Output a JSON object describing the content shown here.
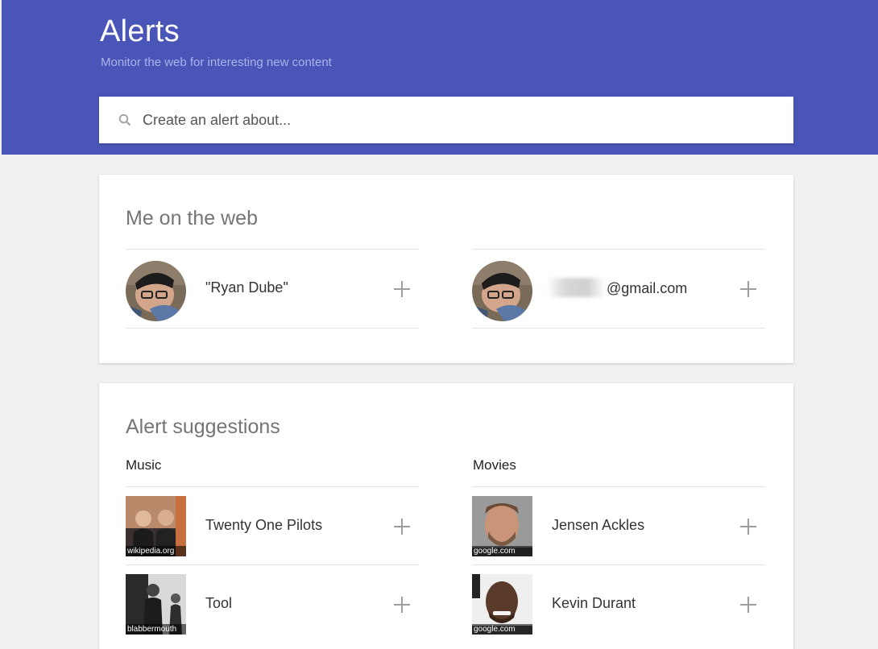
{
  "header": {
    "title": "Alerts",
    "subtitle": "Monitor the web for interesting new content",
    "background": "#4a55b8"
  },
  "search": {
    "placeholder": "Create an alert about...",
    "icon": "search-icon"
  },
  "me_on_web": {
    "title": "Me on the web",
    "items": [
      {
        "label": "\"Ryan Dube\"",
        "icon": "plus-icon"
      },
      {
        "label": "@gmail.com",
        "icon": "plus-icon"
      }
    ]
  },
  "suggestions": {
    "title": "Alert suggestions",
    "columns": [
      {
        "heading": "Music",
        "items": [
          {
            "label": "Twenty One Pilots",
            "source": "wikipedia.org"
          },
          {
            "label": "Tool",
            "source": "blabbermouth"
          }
        ]
      },
      {
        "heading": "Movies",
        "items": [
          {
            "label": "Jensen Ackles",
            "source": "google.com"
          },
          {
            "label": "Kevin Durant",
            "source": "google.com"
          }
        ]
      }
    ]
  }
}
